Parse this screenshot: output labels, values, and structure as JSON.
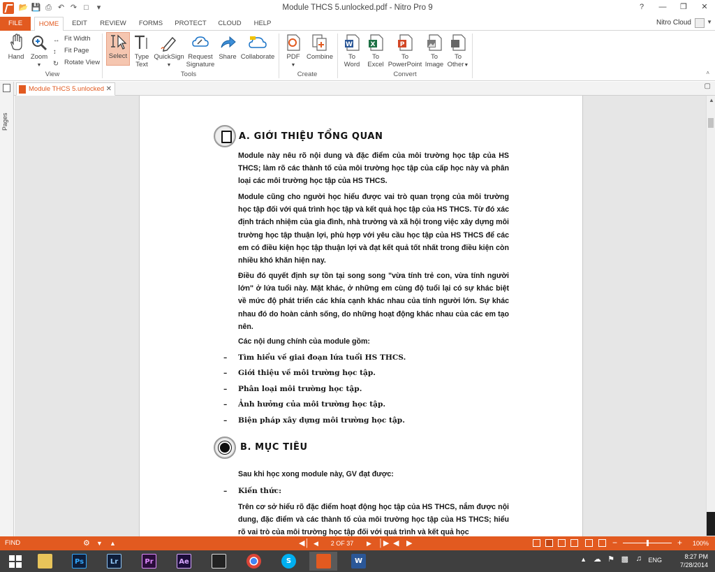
{
  "window": {
    "title": "Module THCS 5.unlocked.pdf - Nitro Pro 9"
  },
  "ribbon_tabs": [
    "FILE",
    "HOME",
    "EDIT",
    "REVIEW",
    "FORMS",
    "PROTECT",
    "CLOUD",
    "HELP"
  ],
  "cloud_user": "Nitro Cloud",
  "ribbon": {
    "hand": "Hand",
    "zoom": "Zoom",
    "fit_width": "Fit Width",
    "fit_page": "Fit Page",
    "rotate_view": "Rotate View",
    "select": "Select",
    "type_text_1": "Type",
    "type_text_2": "Text",
    "quicksign": "QuickSign",
    "request_sig_1": "Request",
    "request_sig_2": "Signature",
    "share": "Share",
    "collaborate": "Collaborate",
    "pdf": "PDF",
    "combine": "Combine",
    "to_word_1": "To",
    "to_word_2": "Word",
    "to_excel_1": "To",
    "to_excel_2": "Excel",
    "to_ppt_1": "To",
    "to_ppt_2": "PowerPoint",
    "to_image_1": "To",
    "to_image_2": "Image",
    "to_other_1": "To",
    "to_other_2": "Other",
    "group_view": "View",
    "group_tools": "Tools",
    "group_create": "Create",
    "group_convert": "Convert"
  },
  "doc_tab": "Module THCS 5.unlocked",
  "pages_panel": "Pages",
  "document": {
    "heading_a": "A. GIỚI THIỆU TỔNG QUAN",
    "p1": "Module này nêu rõ nội dung và đặc điểm của môi trường học tập của HS THCS; làm rõ các thành tố của môi trường học tập của cấp học này và phân loại các môi trường học tập của HS THCS.",
    "p2": "Module cũng cho người học hiểu được vai trò quan trọng của môi trường học tập đối với quá trình học tập và kết quả học tập của HS THCS. Từ đó xác định trách nhiệm của gia đình, nhà trường và xã hội trong việc xây dựng môi trường học tập thuận lợi, phù hợp với yêu cầu học tập của HS THCS để các em có điều kiện học tập thuận lợi và đạt kết quả tốt nhất trong điều kiện còn nhiều khó khăn hiện nay.",
    "p3": "Điều đó quyết định sự tồn tại song song \"vừa tính trẻ con, vừa tính người lớn\" ở lứa tuổi này. Mặt khác, ở những em cùng độ tuổi lại có sự khác biệt về mức độ phát triển các khía cạnh khác nhau của tính người lớn. Sự khác nhau đó do hoàn cảnh sống, do những hoạt động khác nhau của các em tạo nên.",
    "p4": "Các nội dung chính của module gồm:",
    "bullets": [
      "Tìm hiểu về giai đoạn lứa tuổi HS THCS.",
      "Giới thiệu về môi trường học tập.",
      "Phân loại môi trường học tập.",
      "Ảnh hưởng của môi trường học tập.",
      "Biện pháp xây dựng môi trường học tập."
    ],
    "heading_b": "B. MỤC TIÊU",
    "p5": "Sau khi học xong module này, GV đạt được:",
    "bullet_knowledge": "Kiến thức:",
    "p6": "Trên cơ sở hiểu rõ đặc điểm hoạt động học tập của HS THCS, nắm được nội dung, đặc điểm và các thành tố của môi trường học tập của HS THCS; hiểu rõ vai trò của môi trường học tập đối với quá trình và kết quả học"
  },
  "status": {
    "find": "FIND",
    "page_indicator": "2 OF 37",
    "zoom": "100%",
    "zoom_fraction": 0.5
  },
  "taskbar": {
    "apps": [
      "Ps",
      "Lr",
      "Pr",
      "Ae"
    ],
    "lang": "ENG",
    "time": "8:27 PM",
    "date": "7/28/2014"
  },
  "colors": {
    "accent": "#e25a20",
    "taskbar": "#3f3f3f"
  }
}
